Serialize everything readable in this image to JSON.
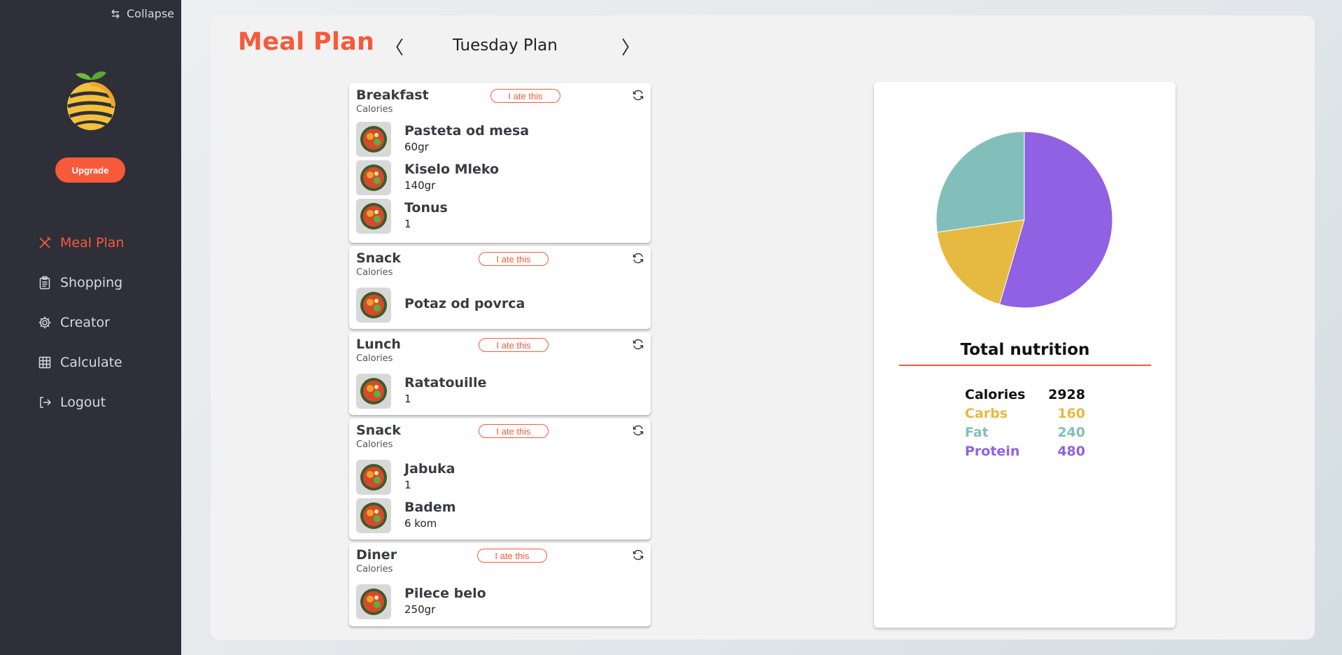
{
  "sidebar": {
    "collapse_label": "Collapse",
    "upgrade_label": "Upgrade",
    "items": [
      {
        "label": "Meal Plan",
        "icon": "fork-knife-icon",
        "active": true
      },
      {
        "label": "Shopping",
        "icon": "clipboard-icon",
        "active": false
      },
      {
        "label": "Creator",
        "icon": "gear-icon",
        "active": false
      },
      {
        "label": "Calculate",
        "icon": "table-icon",
        "active": false
      },
      {
        "label": "Logout",
        "icon": "logout-icon",
        "active": false
      }
    ]
  },
  "header": {
    "title": "Meal Plan",
    "prev": "〈",
    "next": "〉",
    "day_label": "Tuesday Plan"
  },
  "meals": [
    {
      "name": "Breakfast",
      "calories_label": "Calories",
      "ate_label": "I ate this",
      "foods": [
        {
          "name": "Pasteta od mesa",
          "amount": "60gr"
        },
        {
          "name": "Kiselo Mleko",
          "amount": "140gr"
        },
        {
          "name": "Tonus",
          "amount": "1"
        }
      ]
    },
    {
      "name": "Snack",
      "calories_label": "Calories",
      "ate_label": "I ate this",
      "foods": [
        {
          "name": "Potaz od povrca",
          "amount": ""
        }
      ]
    },
    {
      "name": "Lunch",
      "calories_label": "Calories",
      "ate_label": "I ate this",
      "foods": [
        {
          "name": "Ratatouille",
          "amount": "1"
        }
      ]
    },
    {
      "name": "Snack",
      "calories_label": "Calories",
      "ate_label": "I ate this",
      "foods": [
        {
          "name": "Jabuka",
          "amount": "1"
        },
        {
          "name": "Badem",
          "amount": "6 kom"
        }
      ]
    },
    {
      "name": "Diner",
      "calories_label": "Calories",
      "ate_label": "I ate this",
      "foods": [
        {
          "name": "Pilece belo",
          "amount": "250gr"
        }
      ]
    }
  ],
  "nutrition": {
    "title": "Total nutrition",
    "rows": [
      {
        "label": "Calories",
        "value": "2928",
        "color": "#111111"
      },
      {
        "label": "Carbs",
        "value": "160",
        "color": "#e6b940"
      },
      {
        "label": "Fat",
        "value": "240",
        "color": "#82bfba"
      },
      {
        "label": "Protein",
        "value": "480",
        "color": "#9061e2"
      }
    ]
  },
  "chart_data": {
    "type": "pie",
    "slices": [
      {
        "name": "Protein",
        "value": 480,
        "color": "#9061e2"
      },
      {
        "name": "Carbs",
        "value": 160,
        "color": "#e6b940"
      },
      {
        "name": "Fat",
        "value": 240,
        "color": "#82bfba"
      }
    ]
  },
  "colors": {
    "accent": "#f75a3a",
    "sidebar_bg": "#2f2f3a"
  }
}
